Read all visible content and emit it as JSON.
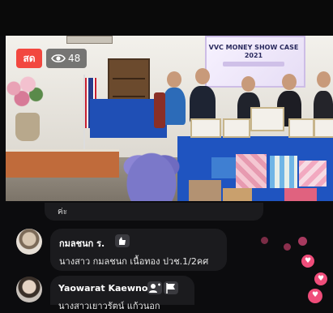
{
  "stream": {
    "live_label": "สด",
    "viewer_count": "48",
    "banner_text": "VVC MONEY SHOW CASE 2021"
  },
  "comments": [
    {
      "text": "ค่ะ"
    },
    {
      "name": "กมลชนก ร.",
      "text": "นางสาว กมลชนก เนื้อทอง ปวช.1/2คศ"
    },
    {
      "name": "Yaowarat Kaewnok",
      "text": "นางสาวเยาวรัตน์ แก้วนอก"
    }
  ],
  "colors": {
    "live_red": "#f2473f",
    "heart_pink": "#ef4d7a"
  },
  "icons": {
    "viewers": "eye-icon",
    "reaction": "heart-icon",
    "commenter_badge": "fan-badge-icon"
  }
}
